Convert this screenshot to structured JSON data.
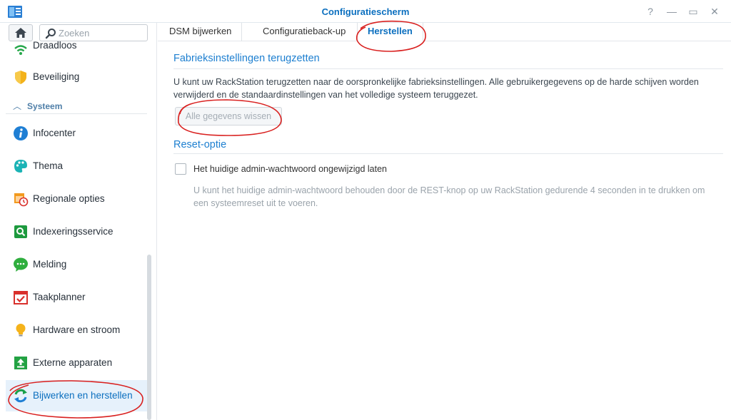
{
  "window": {
    "title": "Configuratiescherm",
    "controls": [
      "?",
      "—",
      "▭",
      "✕"
    ]
  },
  "search": {
    "placeholder": "Zoeken"
  },
  "sidebar": {
    "section": "Systeem",
    "items": [
      {
        "label": "Draadloos",
        "icon": "wifi-icon"
      },
      {
        "label": "Beveiliging",
        "icon": "shield-icon"
      },
      {
        "label": "Infocenter",
        "icon": "info-icon"
      },
      {
        "label": "Thema",
        "icon": "palette-icon"
      },
      {
        "label": "Regionale opties",
        "icon": "calendar-clock-icon"
      },
      {
        "label": "Indexeringsservice",
        "icon": "index-search-icon"
      },
      {
        "label": "Melding",
        "icon": "chat-bubble-icon"
      },
      {
        "label": "Taakplanner",
        "icon": "calendar-check-icon"
      },
      {
        "label": "Hardware en stroom",
        "icon": "lightbulb-icon"
      },
      {
        "label": "Externe apparaten",
        "icon": "upload-icon"
      },
      {
        "label": "Bijwerken en herstellen",
        "icon": "refresh-icon",
        "active": true
      }
    ]
  },
  "tabs": [
    {
      "label": "DSM bijwerken"
    },
    {
      "label": "Configuratieback-up"
    },
    {
      "label": "Herstellen",
      "active": true
    }
  ],
  "content": {
    "factory_title": "Fabrieksinstellingen terugzetten",
    "factory_desc": "U kunt uw RackStation terugzetten naar de oorspronkelijke fabrieksinstellingen. Alle gebruikergegevens op de harde schijven worden verwijderd en de standaardinstellingen van het volledige systeem teruggezet.",
    "wipe_button": "Alle gegevens wissen",
    "reset_title": "Reset-optie",
    "checkbox_label": "Het huidige admin-wachtwoord ongewijzigd laten",
    "checkbox_checked": false,
    "hint": "U kunt het huidige admin-wachtwoord behouden door de REST-knop op uw RackStation gedurende 4 seconden in te drukken om een systeemreset uit te voeren."
  },
  "colors": {
    "accent": "#0b6fbf",
    "section_title": "#1d7fd0",
    "annotation": "#d9201f"
  }
}
